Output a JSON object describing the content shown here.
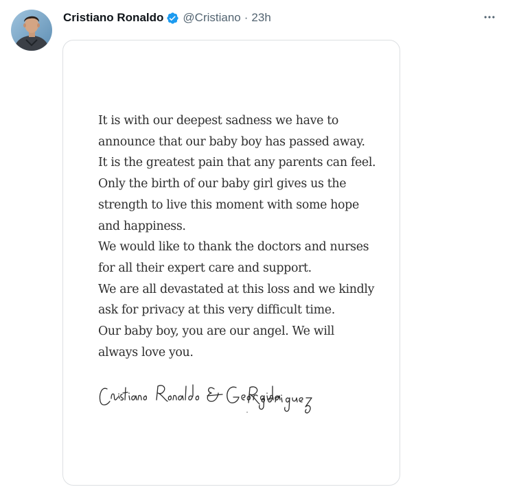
{
  "tweet": {
    "author": {
      "display_name": "Cristiano Ronaldo",
      "handle": "@Cristiano",
      "verified": true
    },
    "separator": "·",
    "timestamp": "23h",
    "more_icon": "more-horizontal-icon",
    "media": {
      "statement_lines": [
        "It is with our deepest sadness we have to",
        "announce that our baby boy has passed away.",
        "It is the greatest pain that any parents can feel.",
        "Only the birth of our baby girl gives us the",
        "strength to live this moment with some hope",
        "and happiness.",
        "We would like to thank the doctors and nurses",
        "for all their expert care and support.",
        "We are all devastated at this loss and we kindly",
        "ask for privacy at this very difficult time.",
        "Our baby boy, you are our angel. We will",
        "always love you."
      ],
      "signature": "Cristiano Ronaldo & Georgina Rodriguez"
    }
  },
  "colors": {
    "text_primary": "#0f1419",
    "text_secondary": "#536471",
    "verified_badge": "#1d9bf0",
    "media_border": "#dcdfe2",
    "statement_text": "#2e2e2e"
  }
}
